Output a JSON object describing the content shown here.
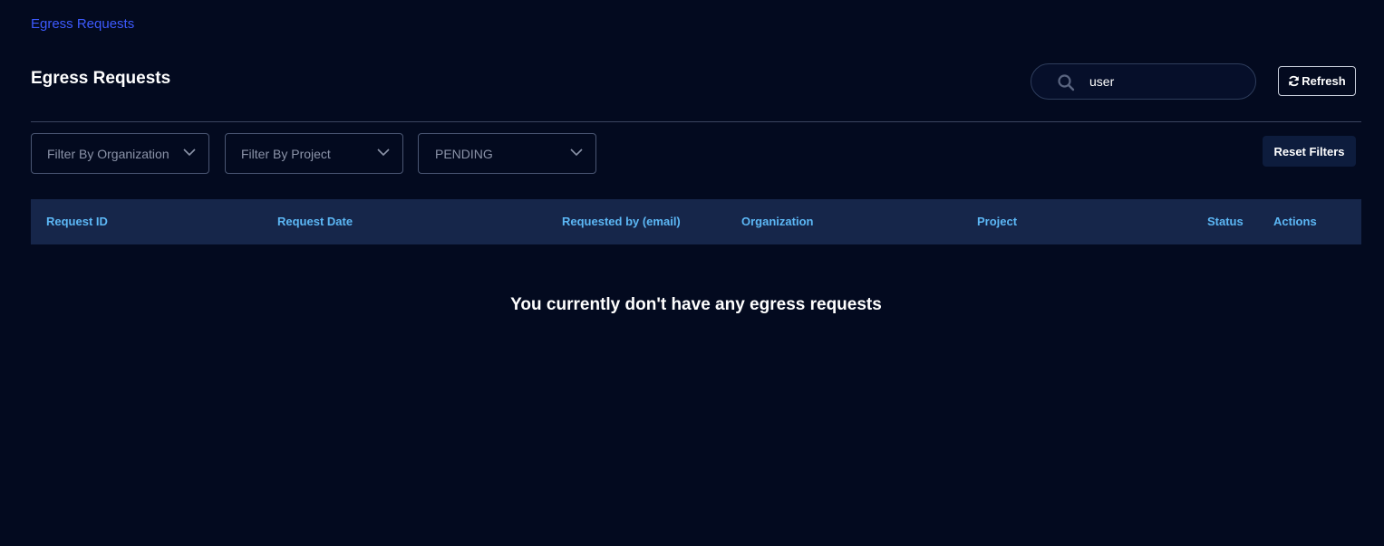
{
  "breadcrumb": {
    "label": "Egress Requests"
  },
  "header": {
    "title": "Egress Requests"
  },
  "search": {
    "value": "user",
    "icon": "search-icon"
  },
  "toolbar": {
    "refresh_label": "Refresh",
    "refresh_icon": "refresh-icon"
  },
  "filters": {
    "organization": "Filter By Organization",
    "project": "Filter By Project",
    "status": "PENDING",
    "reset_label": "Reset Filters"
  },
  "table": {
    "columns": [
      "Request ID",
      "Request Date",
      "Requested by (email)",
      "Organization",
      "Project",
      "Status",
      "Actions"
    ],
    "rows": [],
    "empty_message": "You currently don't have any egress requests"
  },
  "colors": {
    "background": "#030a1f",
    "breadcrumb": "#3d5afe",
    "header_bg": "#16264a",
    "header_text": "#5cb7f5"
  }
}
